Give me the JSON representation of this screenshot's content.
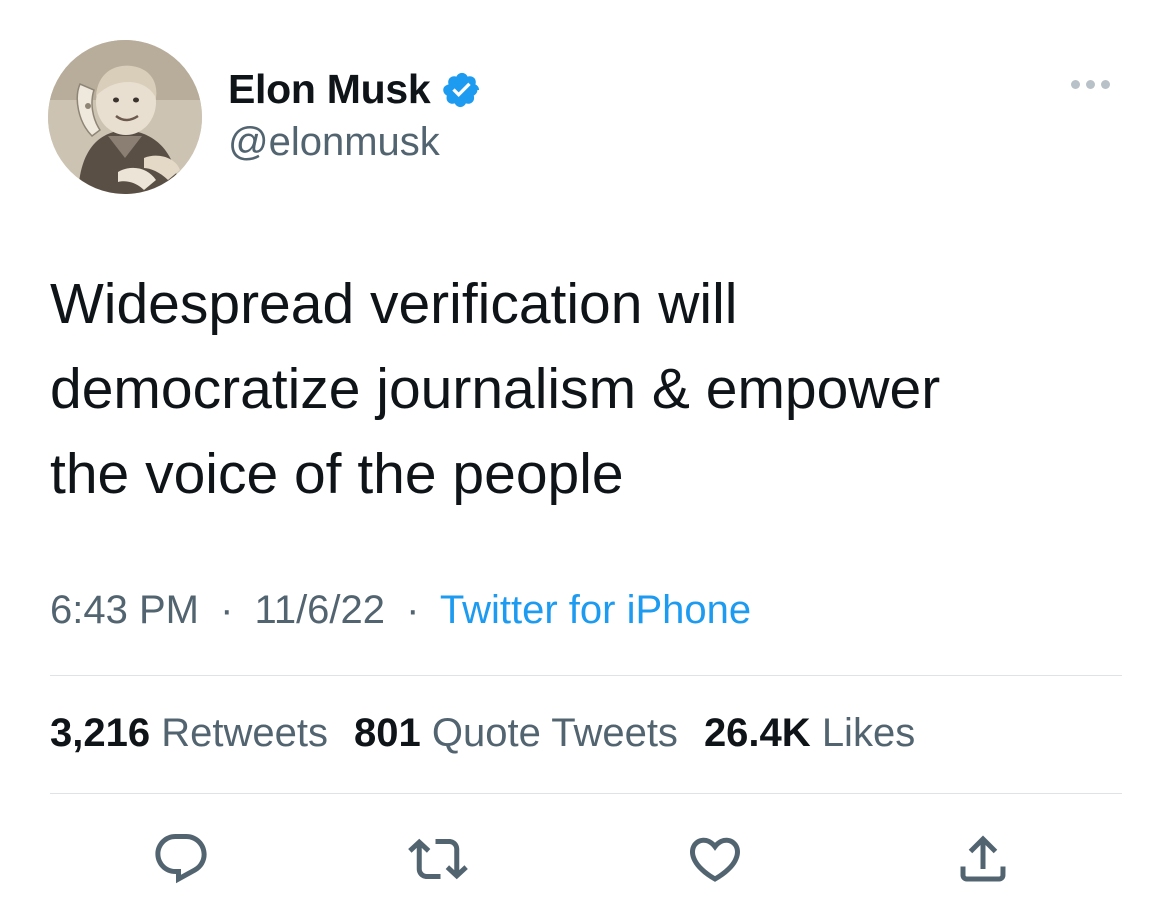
{
  "author": {
    "display_name": "Elon Musk",
    "handle": "@elonmusk",
    "verified": true,
    "verified_color": "#1d9bf0"
  },
  "tweet": {
    "lines": [
      "Widespread verification will",
      "democratize journalism & empower",
      "the voice of the people"
    ],
    "time": "6:43 PM",
    "date": "11/6/22",
    "separator": "·",
    "source": "Twitter for iPhone"
  },
  "stats": {
    "retweets_count": "3,216",
    "retweets_label": "Retweets",
    "quotes_count": "801",
    "quotes_label": "Quote Tweets",
    "likes_count": "26.4K",
    "likes_label": "Likes"
  },
  "icons": {
    "more": "more-icon",
    "reply": "reply-icon",
    "retweet": "retweet-icon",
    "like": "heart-icon",
    "share": "share-icon"
  },
  "colors": {
    "text": "#0f1419",
    "secondary": "#536471",
    "link": "#1d9bf0",
    "divider": "#dfe3e6"
  }
}
